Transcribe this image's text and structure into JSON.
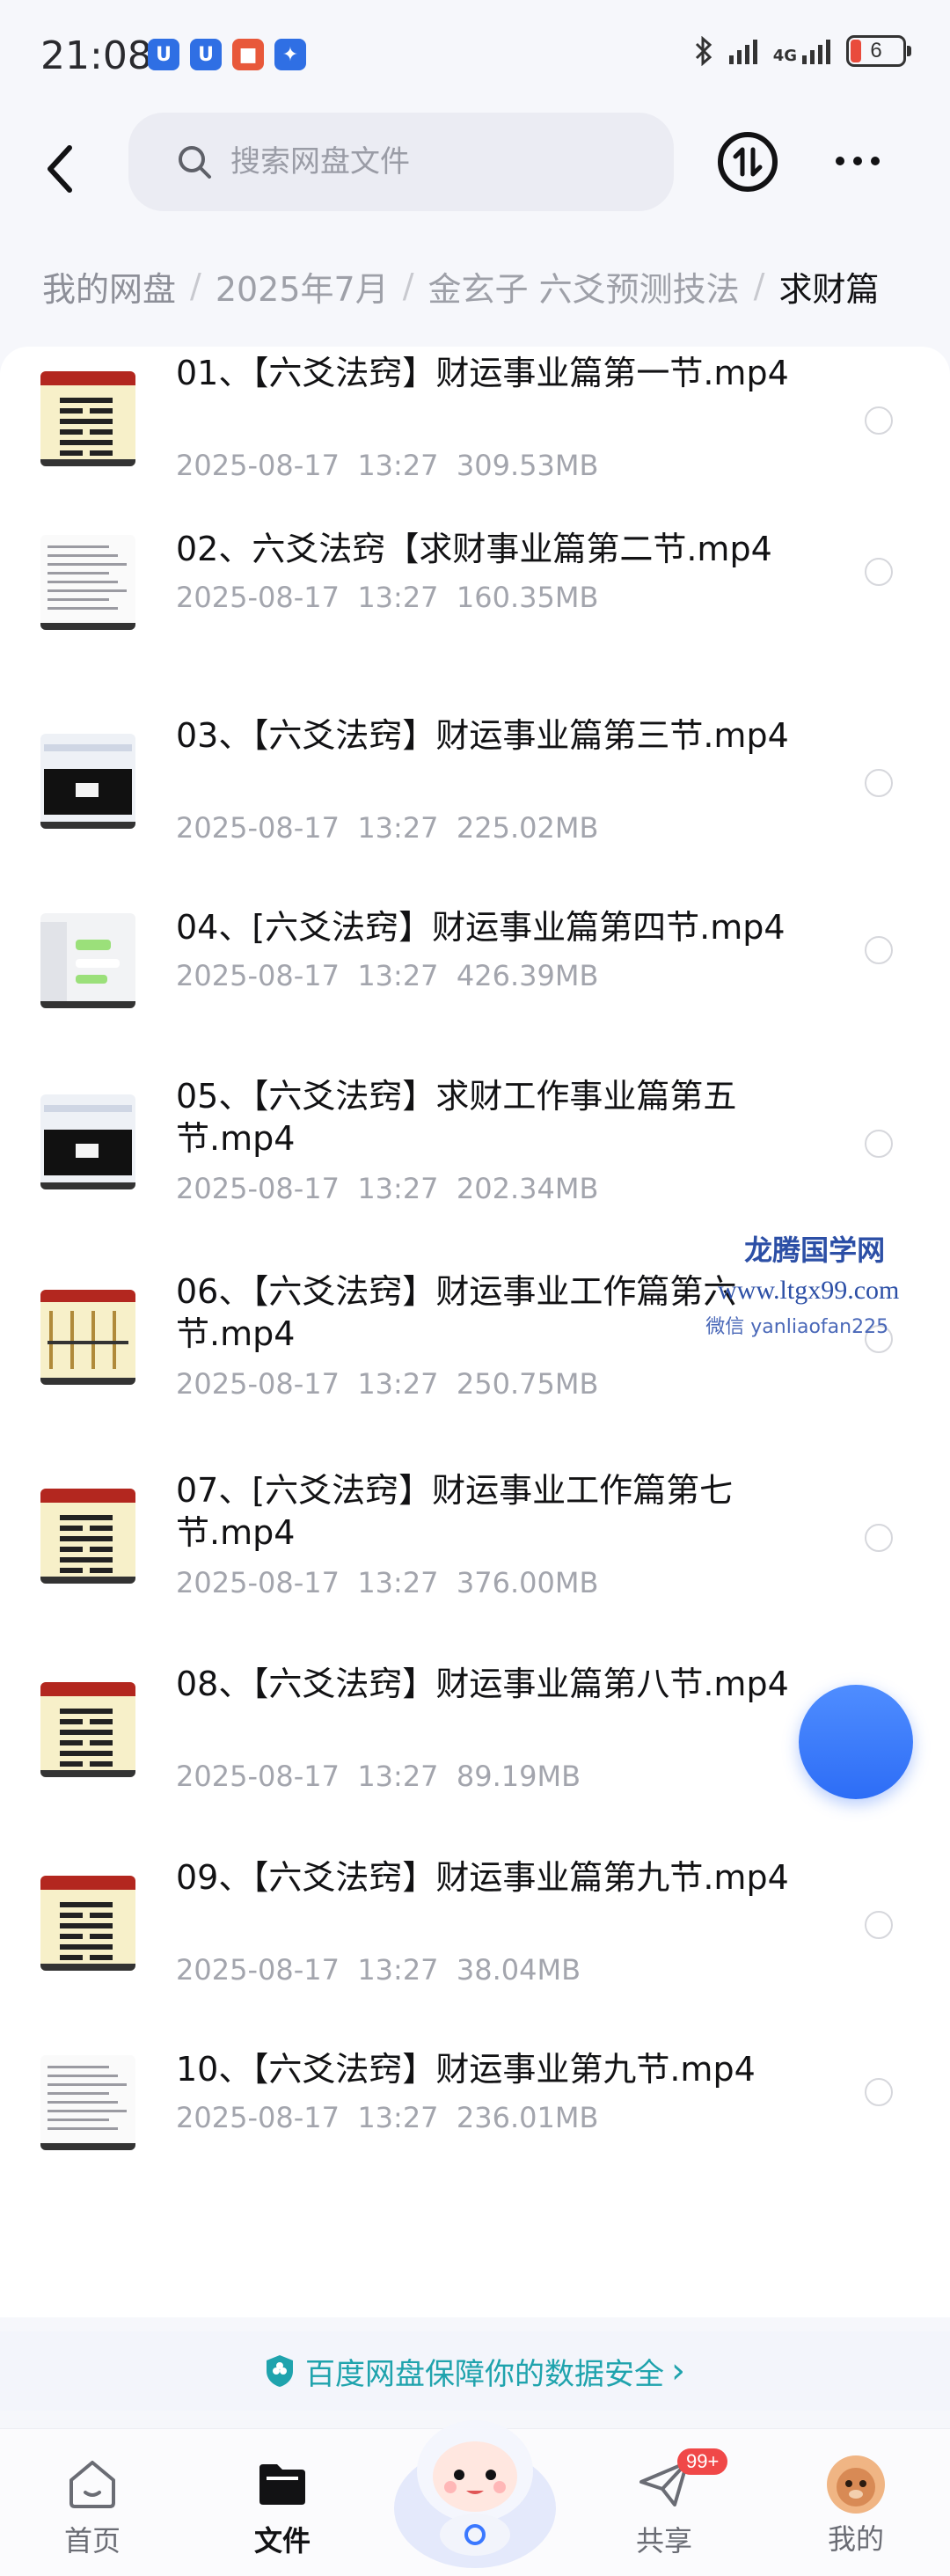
{
  "status_bar": {
    "time": "21:08",
    "network": "4G",
    "battery": "6",
    "app_badges": [
      {
        "icon": "shield-app-icon",
        "color": "#2f6fe4",
        "glyph": "U"
      },
      {
        "icon": "shield-app-icon",
        "color": "#2f6fe4",
        "glyph": "U"
      },
      {
        "icon": "lock-app-icon",
        "color": "#e8583a",
        "glyph": "■"
      },
      {
        "icon": "bulb-app-icon",
        "color": "#2f6fe4",
        "glyph": "✦"
      }
    ]
  },
  "search": {
    "placeholder": "搜索网盘文件"
  },
  "breadcrumb": {
    "items": [
      "我的网盘",
      "2025年7月",
      "金玄子 六爻预测技法",
      "求财篇"
    ]
  },
  "files": [
    {
      "name": "01、【六爻法窍】财运事业篇第一节.mp4",
      "date": "2025-08-17",
      "time": "13:27",
      "size": "309.53MB",
      "thumb": "hexagram"
    },
    {
      "name": "02、六爻法窍【求财事业篇第二节.mp4",
      "date": "2025-08-17",
      "time": "13:27",
      "size": "160.35MB",
      "thumb": "document"
    },
    {
      "name": "03、【六爻法窍】财运事业篇第三节.mp4",
      "date": "2025-08-17",
      "time": "13:27",
      "size": "225.02MB",
      "thumb": "screen"
    },
    {
      "name": "04、[六爻法窍】财运事业篇第四节.mp4",
      "date": "2025-08-17",
      "time": "13:27",
      "size": "426.39MB",
      "thumb": "chat"
    },
    {
      "name": "05、【六爻法窍】求财工作事业篇第五节.mp4",
      "date": "2025-08-17",
      "time": "13:27",
      "size": "202.34MB",
      "thumb": "screen"
    },
    {
      "name": "06、【六爻法窍】财运事业工作篇第六节.mp4",
      "date": "2025-08-17",
      "time": "13:27",
      "size": "250.75MB",
      "thumb": "table"
    },
    {
      "name": "07、[六爻法窍】财运事业工作篇第七节.mp4",
      "date": "2025-08-17",
      "time": "13:27",
      "size": "376.00MB",
      "thumb": "hexagram"
    },
    {
      "name": "08、【六爻法窍】财运事业篇第八节.mp4",
      "date": "2025-08-17",
      "time": "13:27",
      "size": "89.19MB",
      "thumb": "hexagram"
    },
    {
      "name": "09、【六爻法窍】财运事业篇第九节.mp4",
      "date": "2025-08-17",
      "time": "13:27",
      "size": "38.04MB",
      "thumb": "hexagram"
    },
    {
      "name": "10、【六爻法窍】财运事业第九节.mp4",
      "date": "2025-08-17",
      "time": "13:27",
      "size": "236.01MB",
      "thumb": "document"
    }
  ],
  "watermark": {
    "title": "龙腾国学网",
    "url": "www.ltgx99.com",
    "wechat": "微信 yanliaofan225"
  },
  "security_banner": {
    "text": "百度网盘保障你的数据安全",
    "arrow": "›"
  },
  "nav": {
    "home": "首页",
    "files": "文件",
    "share": "共享",
    "share_badge": "99+",
    "me": "我的"
  },
  "colors": {
    "accent": "#2d6df6",
    "banner": "#1fa3ad"
  }
}
